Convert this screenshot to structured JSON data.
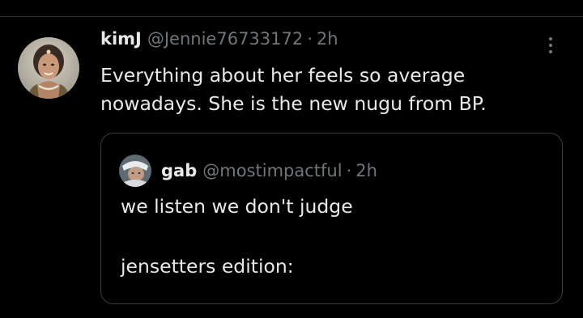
{
  "tweet": {
    "display_name": "kimJ",
    "handle": "@Jennie76733172",
    "separator": "·",
    "time": "2h",
    "text": "Everything about her feels so average\nnowadays. She is the new nugu from BP.",
    "more_icon": "more-vertical-icon"
  },
  "quote": {
    "display_name": "gab",
    "handle": "@mostimpactful",
    "separator": "·",
    "time": "2h",
    "text_line1": "we listen we don't judge",
    "text_line2": "jensetters edition:"
  },
  "colors": {
    "background": "#000000",
    "text_primary": "#e7e9ea",
    "text_secondary": "#71767b",
    "border": "#3a3e42"
  }
}
